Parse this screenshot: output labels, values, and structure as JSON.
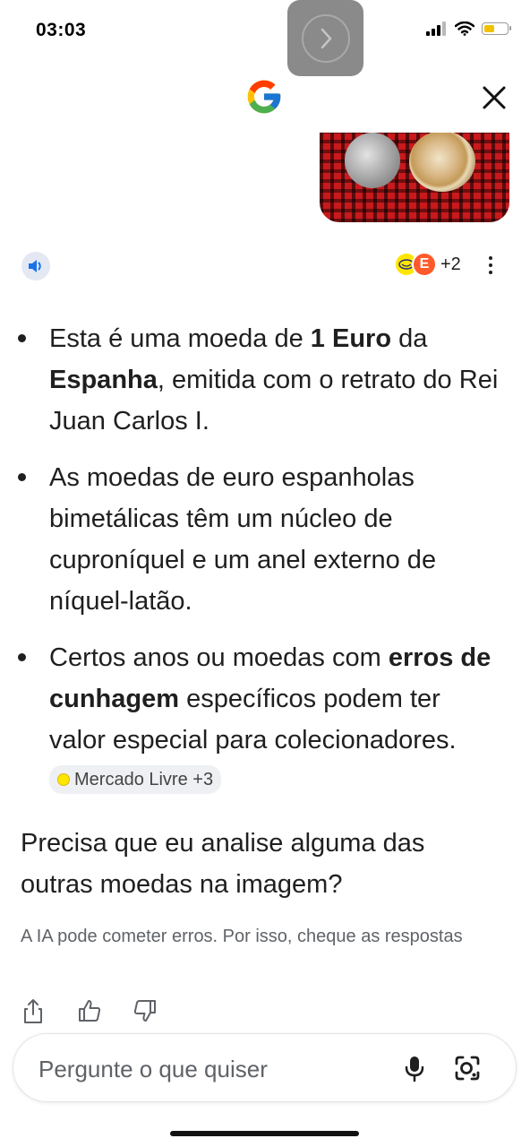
{
  "status_bar": {
    "time": "03:03",
    "battery_level": 0.35,
    "battery_color": "#f2c200"
  },
  "header": {
    "logo_icon": "google-g-icon",
    "close_icon": "close-icon"
  },
  "image": {
    "description_icon": "coin-photo"
  },
  "sources": {
    "count_label": "+2"
  },
  "bullets": {
    "b1": {
      "t1": "Esta é uma moeda de ",
      "b1": "1 Euro",
      "t2": " da ",
      "b2": "Espanha",
      "t3": ", emitida com o retrato do Rei Juan Carlos I."
    },
    "b2": {
      "t1": "As moedas de euro espanholas bimetálicas têm um núcleo de cuproníquel e um anel externo de níquel-latão."
    },
    "b3": {
      "t1": "Certos anos ou moedas com ",
      "b1": "erros de cunhagem",
      "t2": " específicos podem ter valor especial para colecionadores. ",
      "chip": "Mercado Livre +3"
    }
  },
  "question": "Precisa que eu analise alguma das outras moedas na imagem?",
  "disclaimer": "A IA pode cometer erros. Por isso, cheque as respostas",
  "input": {
    "placeholder": "Pergunte o que quiser"
  },
  "colors": {
    "accent_blue": "#1a73e8",
    "text": "#1f1f1f",
    "muted": "#5f6368"
  }
}
